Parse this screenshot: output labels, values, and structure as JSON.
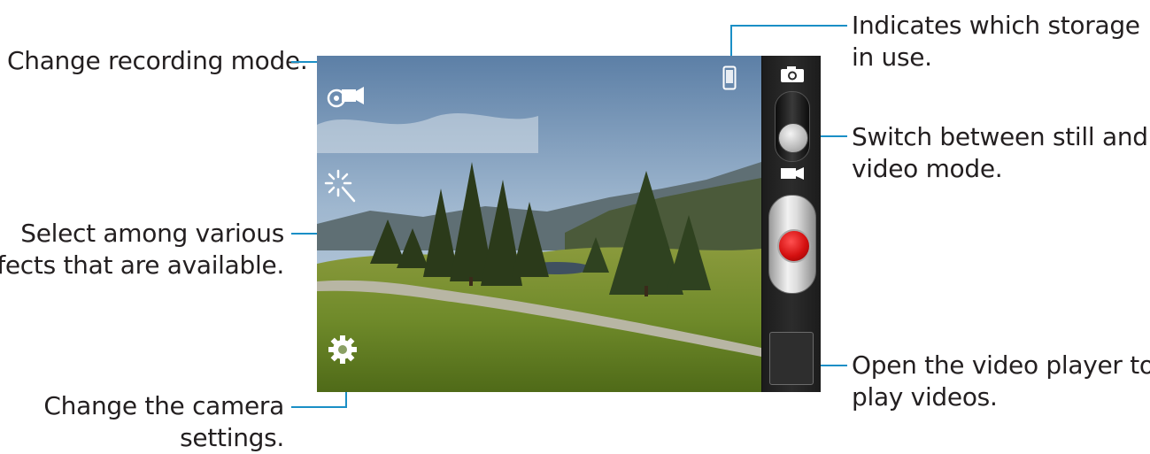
{
  "callouts": {
    "recording_mode": "Change recording mode.",
    "effects": [
      "Select among various",
      "effects that are available."
    ],
    "camera_settings": [
      "Change the camera",
      "settings."
    ],
    "storage": [
      "Indicates which storage is",
      "in use."
    ],
    "still_video_switch": [
      "Switch between still and",
      "video mode."
    ],
    "video_player": [
      "Open the video player to",
      "play videos."
    ]
  },
  "viewfinder_icons": [
    "video-recording-mode-icon",
    "effects-wand-icon",
    "settings-gear-icon",
    "phone-storage-icon"
  ],
  "control_icons": [
    "camera-icon",
    "mode-switch",
    "video-camera-icon",
    "record-button",
    "gallery-thumbnail"
  ],
  "colors": {
    "leader_line": "#1a8fc6",
    "record": "#d41010"
  }
}
